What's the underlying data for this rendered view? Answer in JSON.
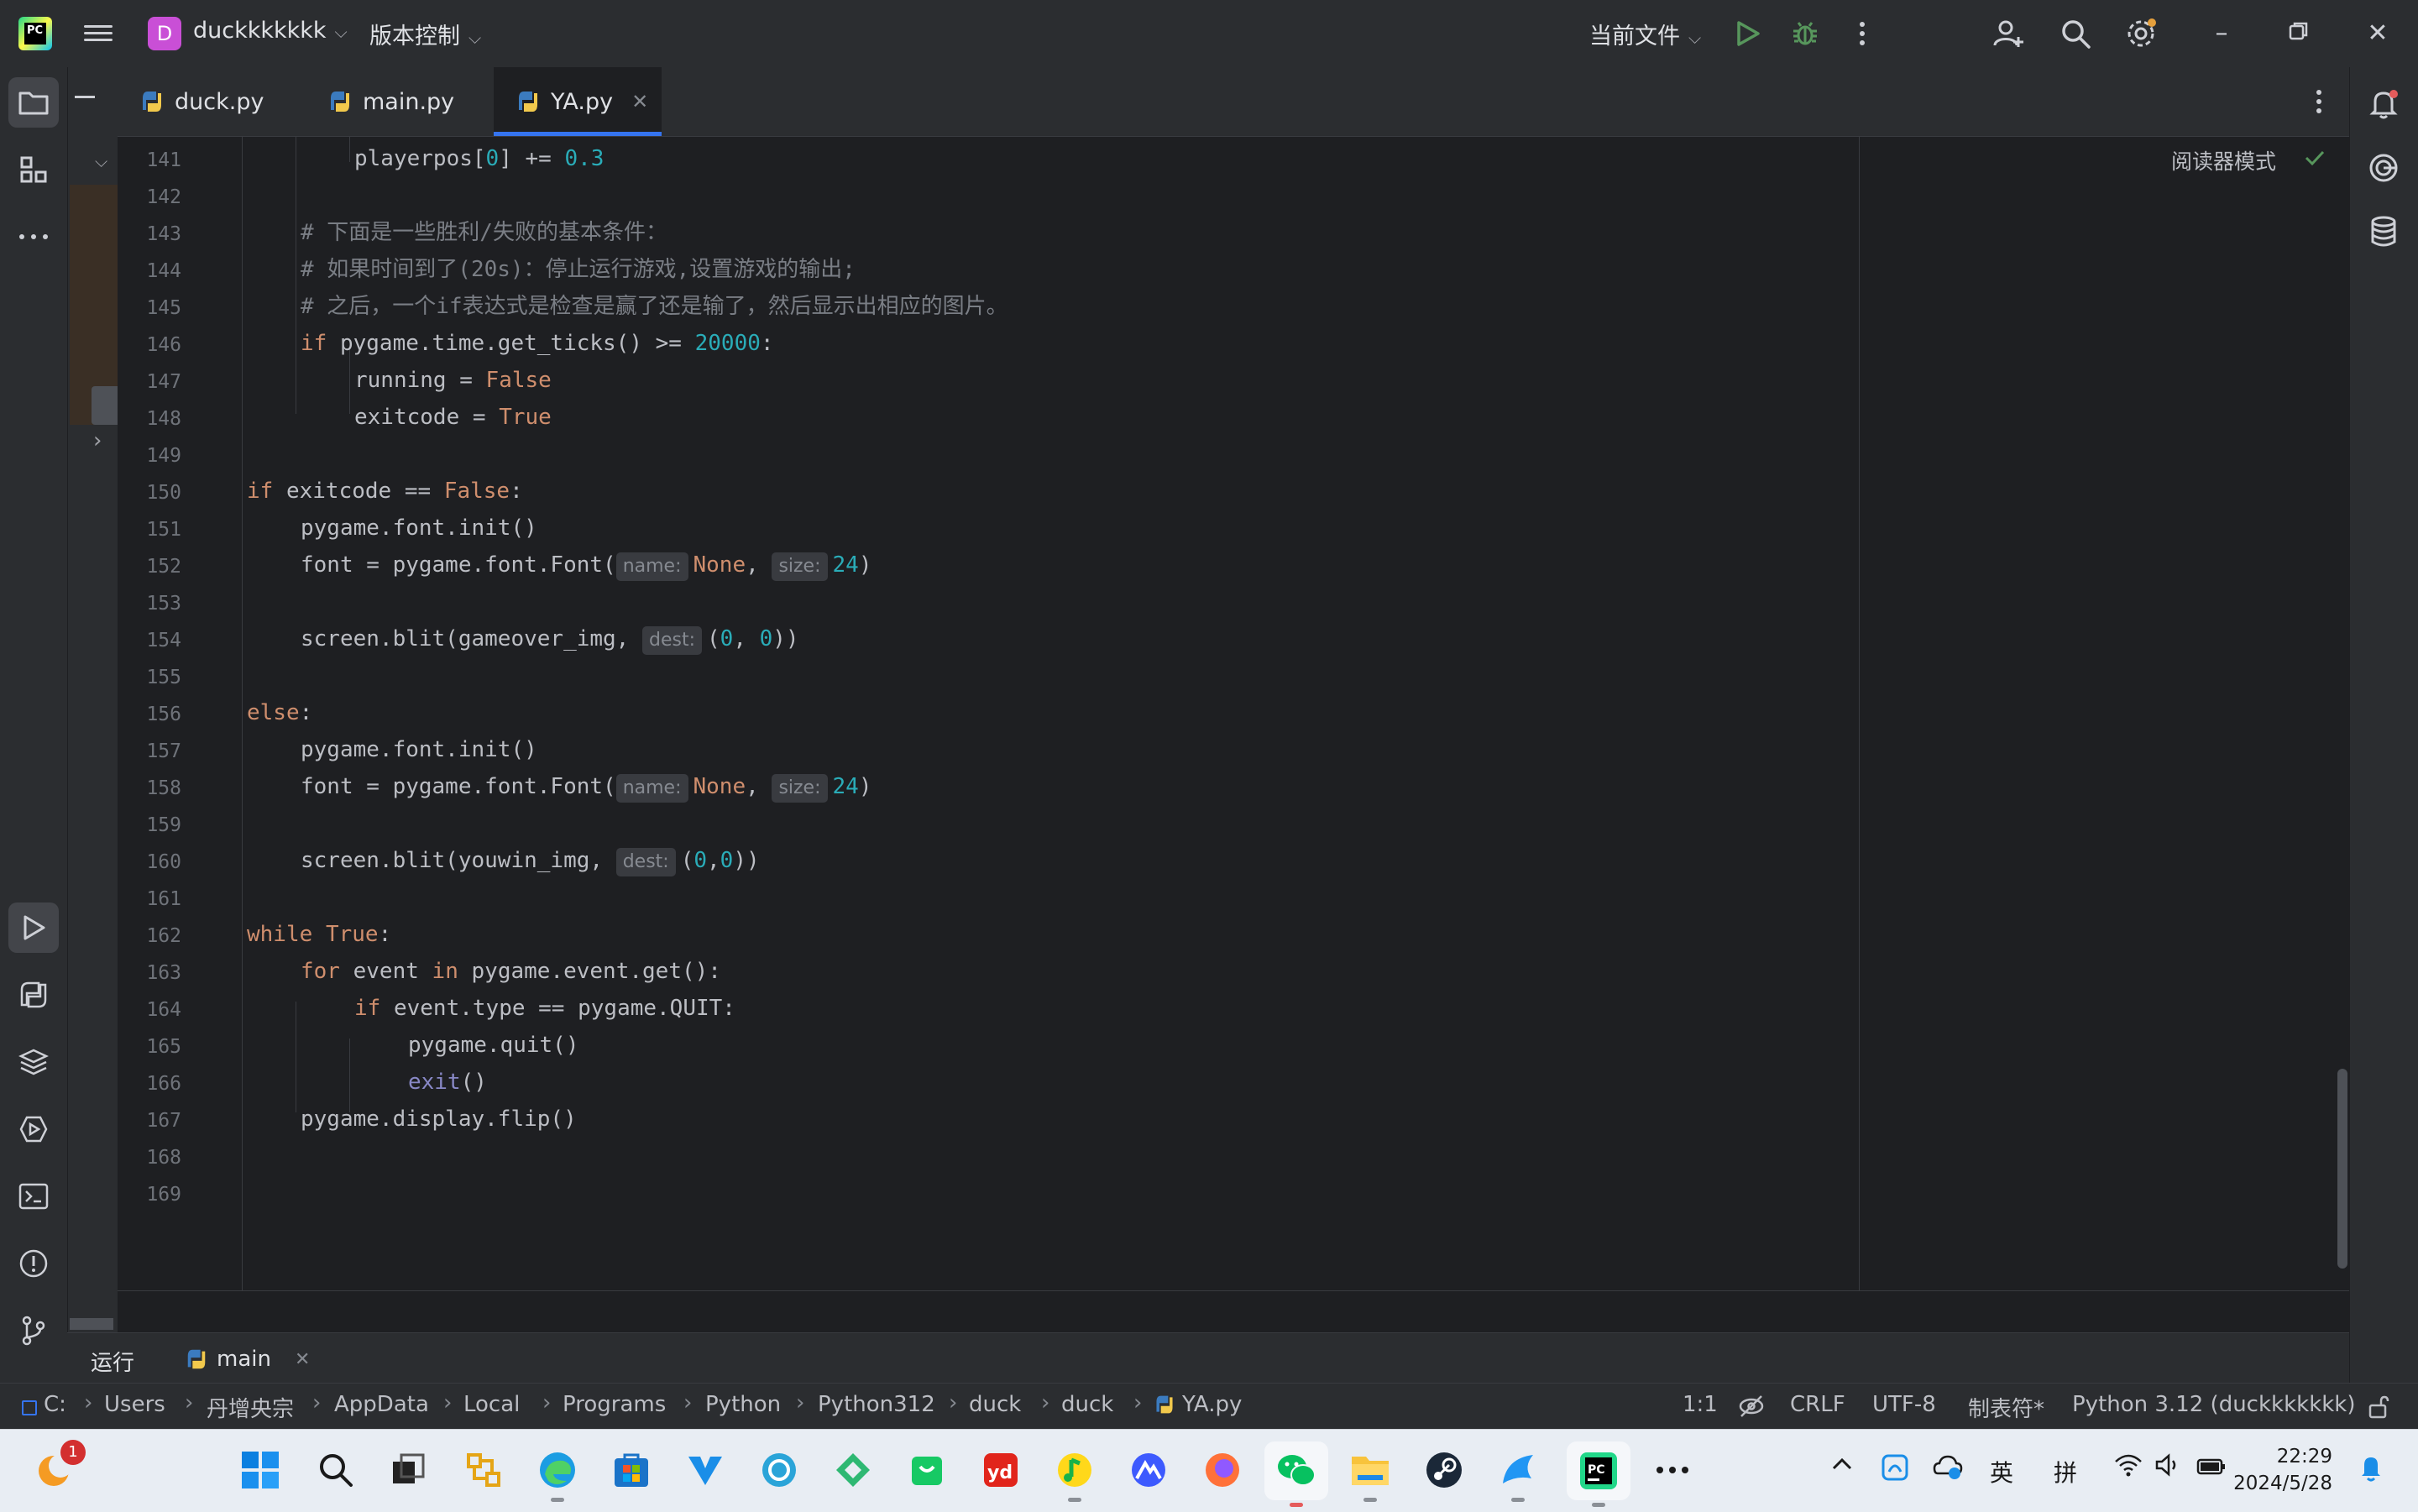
{
  "titlebar": {
    "project_initial": "D",
    "project_name": "duckkkkkkk",
    "vcs_label": "版本控制",
    "run_config": "当前文件"
  },
  "tabs": [
    {
      "label": "duck.py"
    },
    {
      "label": "main.py"
    },
    {
      "label": "YA.py",
      "active": true
    }
  ],
  "editor": {
    "reader_mode": "阅读器模式",
    "lines": [
      {
        "n": "141"
      },
      {
        "n": "142"
      },
      {
        "n": "143"
      },
      {
        "n": "144"
      },
      {
        "n": "145"
      },
      {
        "n": "146"
      },
      {
        "n": "147"
      },
      {
        "n": "148"
      },
      {
        "n": "149"
      },
      {
        "n": "150"
      },
      {
        "n": "151"
      },
      {
        "n": "152"
      },
      {
        "n": "153"
      },
      {
        "n": "154"
      },
      {
        "n": "155"
      },
      {
        "n": "156"
      },
      {
        "n": "157"
      },
      {
        "n": "158"
      },
      {
        "n": "159"
      },
      {
        "n": "160"
      },
      {
        "n": "161"
      },
      {
        "n": "162"
      },
      {
        "n": "163"
      },
      {
        "n": "164"
      },
      {
        "n": "165"
      },
      {
        "n": "166"
      },
      {
        "n": "167"
      },
      {
        "n": "168"
      },
      {
        "n": "169"
      }
    ],
    "code": {
      "l141": {
        "a": "playerpos[",
        "b": "0",
        "c": "] += ",
        "d": "0.3"
      },
      "l143": "# 下面是一些胜利/失败的基本条件：",
      "l144": "# 如果时间到了(20s)：停止运行游戏,设置游戏的输出;",
      "l145": "# 之后，一个if表达式是检查是赢了还是输了，然后显示出相应的图片。",
      "l146": {
        "kw": "if",
        "a": " pygame.time.get_ticks() >= ",
        "num": "20000",
        "b": ":"
      },
      "l147": {
        "a": "running = ",
        "kw": "False"
      },
      "l148": {
        "a": "exitcode = ",
        "kw": "True"
      },
      "l150": {
        "kw": "if",
        "a": " exitcode == ",
        "kw2": "False",
        "b": ":"
      },
      "l151": "pygame.font.init()",
      "l152": {
        "a": "font = pygame.font.Font(",
        "hint1": "name:",
        "kw": "None",
        "b": ", ",
        "hint2": "size:",
        "num": "24",
        "c": ")"
      },
      "l154": {
        "a": "screen.blit(gameover_img, ",
        "hint": "dest:",
        "b": "(",
        "n1": "0",
        "c": ", ",
        "n2": "0",
        "d": "))"
      },
      "l156": {
        "kw": "else",
        "a": ":"
      },
      "l157": "pygame.font.init()",
      "l158": {
        "a": "font = pygame.font.Font(",
        "hint1": "name:",
        "kw": "None",
        "b": ", ",
        "hint2": "size:",
        "num": "24",
        "c": ")"
      },
      "l160": {
        "a": "screen.blit(youwin_img, ",
        "hint": "dest:",
        "b": "(",
        "n1": "0",
        "c": ",",
        "n2": "0",
        "d": "))"
      },
      "l162": {
        "kw": "while",
        "a": " ",
        "kw2": "True",
        "b": ":"
      },
      "l163": {
        "kw": "for",
        "a": " event ",
        "kw2": "in",
        "b": " pygame.event.get():"
      },
      "l164": {
        "kw": "if",
        "a": " event.type == pygame.QUIT:"
      },
      "l165": "pygame.quit()",
      "l166": {
        "bi": "exit",
        "a": "()"
      },
      "l167": "pygame.display.flip()"
    }
  },
  "runpanel": {
    "label": "运行",
    "config": "main"
  },
  "statusbar": {
    "path": [
      "C:",
      "Users",
      "丹增央宗",
      "AppData",
      "Local",
      "Programs",
      "Python",
      "Python312",
      "duck",
      "duck",
      "YA.py"
    ],
    "position": "1:1",
    "line_sep": "CRLF",
    "encoding": "UTF-8",
    "indent": "制表符*",
    "interpreter": "Python 3.12 (duckkkkkkk)"
  },
  "taskbar": {
    "badge_count": "1",
    "ime_lang": "英",
    "ime_mode": "拼",
    "time": "22:29",
    "date": "2024/5/28"
  },
  "colors": {
    "accent": "#3574f0",
    "keyword": "#cf8e6d",
    "number": "#2aacb8",
    "comment": "#7a7e85"
  }
}
